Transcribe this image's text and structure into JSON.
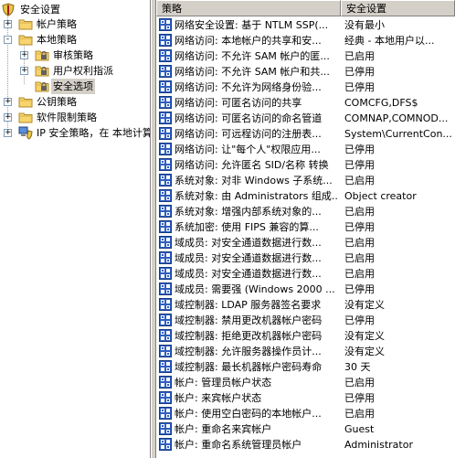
{
  "tree": {
    "nodes": [
      {
        "label": "安全设置",
        "icon": "shield-icon"
      },
      {
        "label": "帐户策略",
        "icon": "folder-icon",
        "expander": "+"
      },
      {
        "label": "本地策略",
        "icon": "folder-icon",
        "expander": "−"
      },
      {
        "label": "审核策略",
        "icon": "folder-lock-icon",
        "expander": "+"
      },
      {
        "label": "用户权利指派",
        "icon": "folder-lock-icon",
        "expander": "+"
      },
      {
        "label": "安全选项",
        "icon": "folder-lock-icon"
      },
      {
        "label": "公钥策略",
        "icon": "folder-icon",
        "expander": "+"
      },
      {
        "label": "软件限制策略",
        "icon": "folder-icon",
        "expander": "+"
      },
      {
        "label": "IP 安全策略，在 本地计算机",
        "icon": "ip-security-icon",
        "expander": "+"
      }
    ]
  },
  "list": {
    "columns": [
      "策略",
      "安全设置"
    ],
    "rows": [
      {
        "policy": "网络安全设置: 基于 NTLM SSP(...",
        "setting": "没有最小"
      },
      {
        "policy": "网络访问: 本地帐户的共享和安...",
        "setting": "经典 - 本地用户以..."
      },
      {
        "policy": "网络访问: 不允许 SAM 帐户的匿...",
        "setting": "已启用"
      },
      {
        "policy": "网络访问: 不允许 SAM 帐户和共...",
        "setting": "已停用"
      },
      {
        "policy": "网络访问: 不允许为网络身份验...",
        "setting": "已停用"
      },
      {
        "policy": "网络访问: 可匿名访问的共享",
        "setting": "COMCFG,DFS$"
      },
      {
        "policy": "网络访问: 可匿名访问的命名管道",
        "setting": "COMNAP,COMNOD..."
      },
      {
        "policy": "网络访问: 可远程访问的注册表...",
        "setting": "System\\CurrentCon..."
      },
      {
        "policy": "网络访问: 让\"每个人\"权限应用...",
        "setting": "已停用"
      },
      {
        "policy": "网络访问: 允许匿名 SID/名称 转换",
        "setting": "已停用"
      },
      {
        "policy": "系统对象: 对非 Windows 子系统...",
        "setting": "已启用"
      },
      {
        "policy": "系统对象: 由 Administrators 组成...",
        "setting": "Object creator"
      },
      {
        "policy": "系统对象: 增强内部系统对象的...",
        "setting": "已启用"
      },
      {
        "policy": "系统加密: 使用 FIPS 兼容的算...",
        "setting": "已停用"
      },
      {
        "policy": "域成员: 对安全通道数据进行数...",
        "setting": "已启用"
      },
      {
        "policy": "域成员: 对安全通道数据进行数...",
        "setting": "已启用"
      },
      {
        "policy": "域成员: 对安全通道数据进行数...",
        "setting": "已启用"
      },
      {
        "policy": "域成员: 需要强 (Windows 2000 ...",
        "setting": "已停用"
      },
      {
        "policy": "域控制器: LDAP 服务器签名要求",
        "setting": "没有定义"
      },
      {
        "policy": "域控制器: 禁用更改机器帐户密码",
        "setting": "已停用"
      },
      {
        "policy": "域控制器: 拒绝更改机器帐户密码",
        "setting": "没有定义"
      },
      {
        "policy": "域控制器: 允许服务器操作员计...",
        "setting": "没有定义"
      },
      {
        "policy": "域控制器: 最长机器帐户密码寿命",
        "setting": "30 天"
      },
      {
        "policy": "帐户: 管理员帐户状态",
        "setting": "已启用"
      },
      {
        "policy": "帐户: 来宾帐户状态",
        "setting": "已停用"
      },
      {
        "policy": "帐户: 使用空白密码的本地帐户...",
        "setting": "已启用"
      },
      {
        "policy": "帐户: 重命名来宾帐户",
        "setting": "Guest"
      },
      {
        "policy": "帐户: 重命名系统管理员帐户",
        "setting": "Administrator"
      }
    ]
  }
}
